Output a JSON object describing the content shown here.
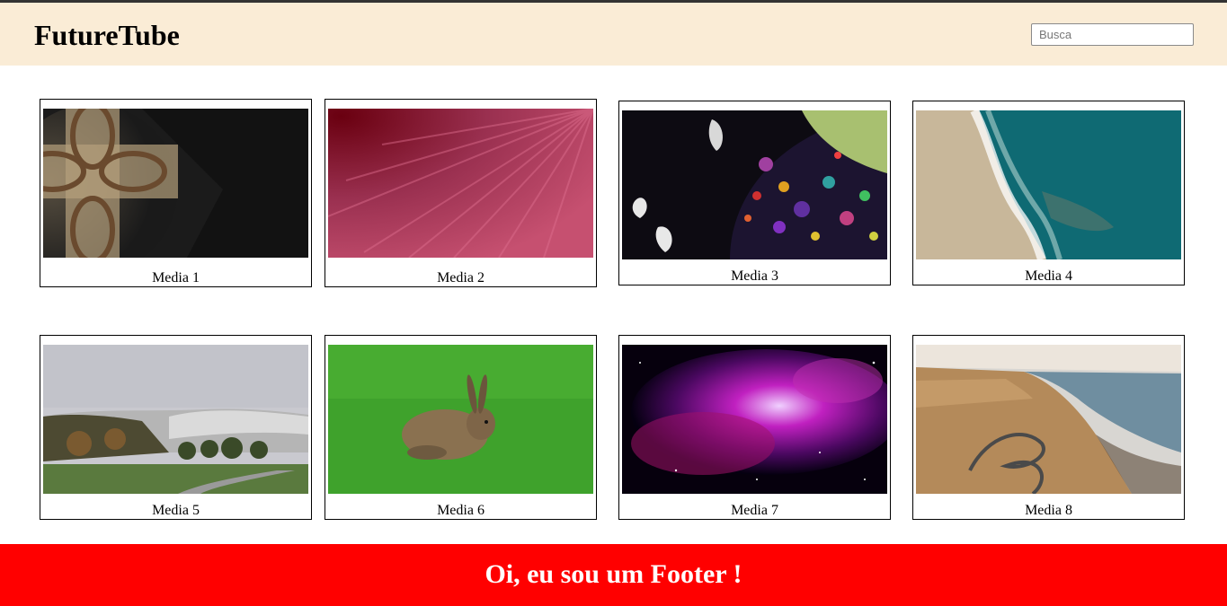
{
  "header": {
    "brand": "FutureTube",
    "search_placeholder": "Busca",
    "search_value": ""
  },
  "media": [
    {
      "title": "Media 1"
    },
    {
      "title": "Media 2"
    },
    {
      "title": "Media 3"
    },
    {
      "title": "Media 4"
    },
    {
      "title": "Media 5"
    },
    {
      "title": "Media 6"
    },
    {
      "title": "Media 7"
    },
    {
      "title": "Media 8"
    }
  ],
  "footer": {
    "text": "Oi, eu sou um Footer !"
  },
  "colors": {
    "header_bg": "#faecd6",
    "footer_bg": "#ff0000",
    "footer_text": "#ffffff"
  }
}
